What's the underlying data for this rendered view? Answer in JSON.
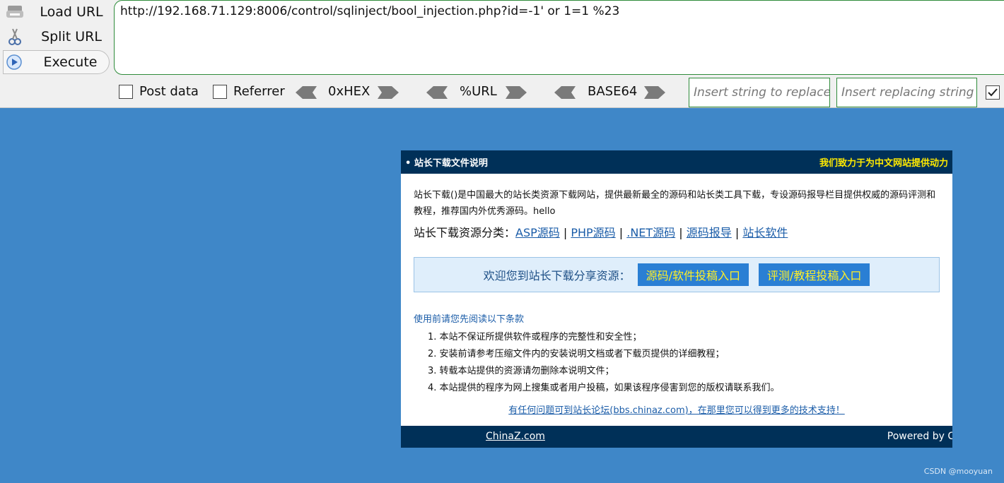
{
  "hackbar": {
    "load_url": "Load URL",
    "split_url": "Split URL",
    "execute": "Execute",
    "url_value": "http://192.168.71.129:8006/control/sqlinject/bool_injection.php?id=-1' or 1=1  %23",
    "post_data": "Post data",
    "referrer": "Referrer",
    "hex": "0xHEX",
    "url_enc": "%URL",
    "base64": "BASE64",
    "replace_placeholder": "Insert string to replace",
    "replacing_placeholder": "Insert replacing string"
  },
  "panel": {
    "header_left": "• 站长下载文件说明",
    "header_right": "我们致力于为中文网站提供动力",
    "intro": "站长下载()是中国最大的站长类资源下载网站，提供最新最全的源码和站长类工具下载，专设源码报导栏目提供权威的源码评测和教程，推荐国内外优秀源码。hello",
    "categories_label": "站长下载资源分类：",
    "categories": [
      "ASP源码",
      "PHP源码",
      ".NET源码",
      "源码报导",
      "站长软件"
    ],
    "welcome_text": "欢迎您到站长下载分享资源：",
    "welcome_btn1": "源码/软件投稿入口",
    "welcome_btn2": "评测/教程投稿入口",
    "terms_title": "使用前请您先阅读以下条款",
    "terms": [
      "1. 本站不保证所提供软件或程序的完整性和安全性；",
      "2. 安装前请参考压缩文件内的安装说明文档或者下载页提供的详细教程；",
      "3. 转载本站提供的资源请勿删除本说明文件；",
      "4. 本站提供的程序为网上搜集或者用户投稿，如果该程序侵害到您的版权请联系我们。"
    ],
    "forum_link": "有任何问题可到站长论坛(bbs.chinaz.com)，在那里您可以得到更多的技术支持！",
    "footer_left": "ChinaZ.com",
    "footer_right": "Powered by Ch"
  },
  "watermark": "CSDN @mooyuan",
  "colors": {
    "page_bg": "#3f87c8",
    "panel_head": "#003058",
    "accent_green": "#2e8b3a",
    "link": "#1a5ca8"
  }
}
